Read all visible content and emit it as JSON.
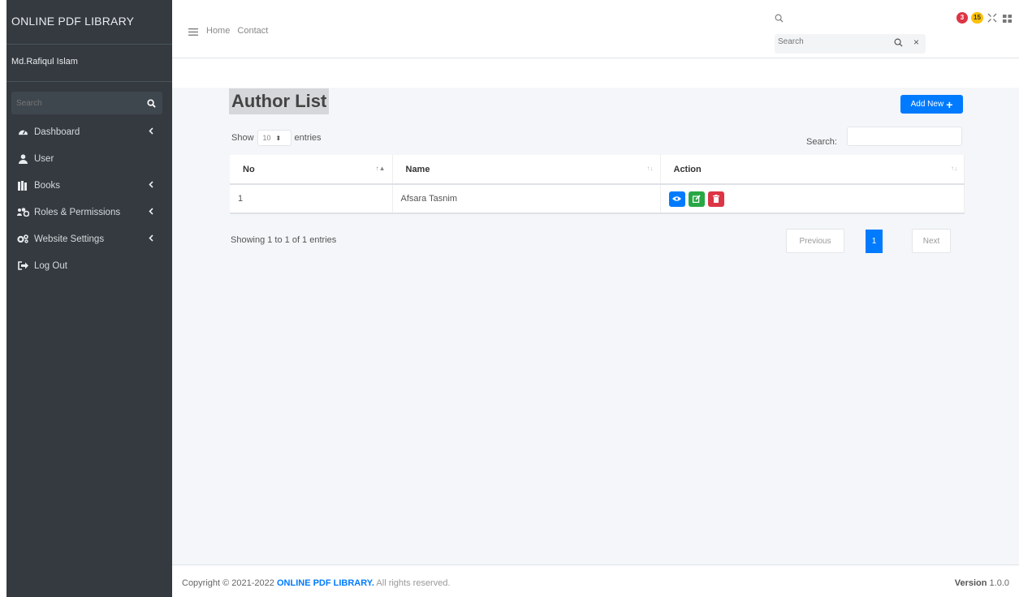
{
  "sidebar": {
    "brand": "ONLINE PDF LIBRARY",
    "user_name": "Md.Rafiqul Islam",
    "search_placeholder": "Search",
    "items": [
      {
        "label": "Dashboard",
        "icon": "tachometer-icon",
        "has_submenu": true
      },
      {
        "label": "User",
        "icon": "user-icon",
        "has_submenu": false
      },
      {
        "label": "Books",
        "icon": "book-icon",
        "has_submenu": true
      },
      {
        "label": "Roles & Permissions",
        "icon": "users-cog-icon",
        "has_submenu": true
      },
      {
        "label": "Website Settings",
        "icon": "cogs-icon",
        "has_submenu": true
      },
      {
        "label": "Log Out",
        "icon": "sign-out-icon",
        "has_submenu": false
      }
    ]
  },
  "topbar": {
    "nav_home": "Home",
    "nav_contact": "Contact",
    "search_placeholder": "Search",
    "badge_messages": "3",
    "badge_notifications": "15"
  },
  "main": {
    "title": "Author List",
    "add_button": "Add New",
    "show_label": "Show",
    "entries_value": "10",
    "entries_label": "entries",
    "search_label": "Search:",
    "columns": [
      "No",
      "Name",
      "Action"
    ],
    "rows": [
      {
        "no": "1",
        "name": "Afsara Tasnim"
      }
    ],
    "info": "Showing 1 to 1 of 1 entries",
    "pagination": {
      "previous": "Previous",
      "current": "1",
      "next": "Next"
    }
  },
  "footer": {
    "copyright_prefix": "Copyright © 2021-2022",
    "brand": "ONLINE PDF LIBRARY.",
    "rights": "All rights reserved.",
    "version_label": "Version",
    "version_value": "1.0.0"
  },
  "colors": {
    "sidebar_bg": "#343a40",
    "primary": "#007bff",
    "success": "#28a745",
    "danger": "#dc3545",
    "warning": "#ffc107"
  }
}
